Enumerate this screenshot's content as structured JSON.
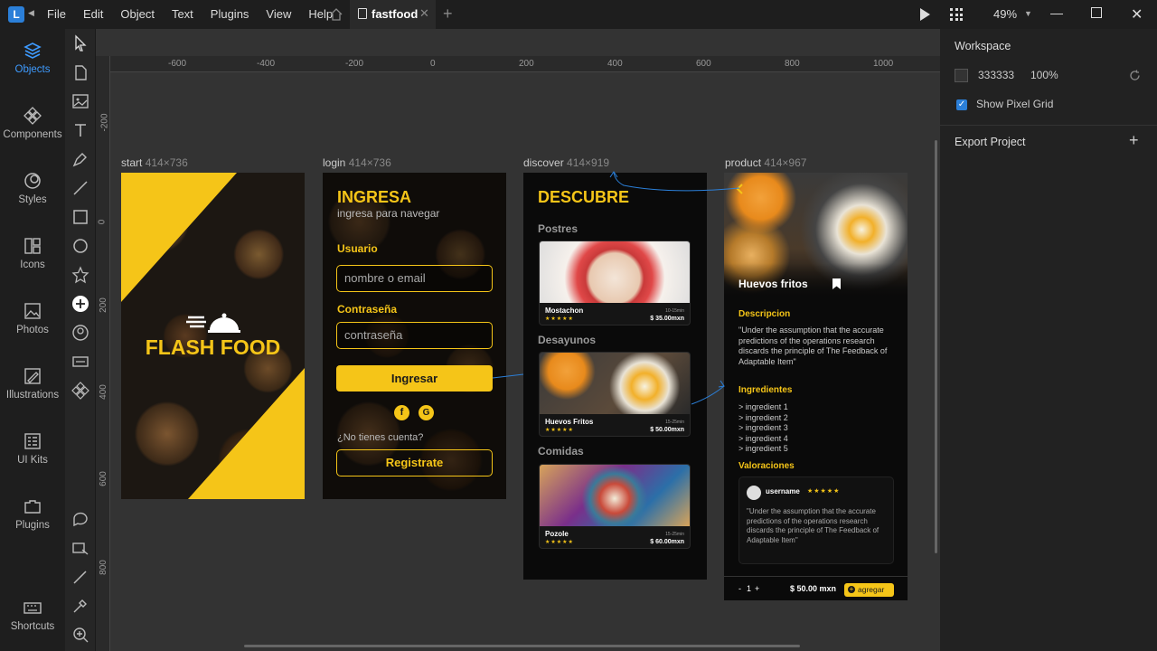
{
  "app": {
    "menu": [
      "File",
      "Edit",
      "Object",
      "Text",
      "Plugins",
      "View",
      "Help"
    ],
    "tab_name": "fastfood",
    "zoom": "49%"
  },
  "leftbar": {
    "items": [
      {
        "label": "Objects",
        "icon": "layers-icon"
      },
      {
        "label": "Components",
        "icon": "components-icon"
      },
      {
        "label": "Styles",
        "icon": "styles-icon"
      },
      {
        "label": "Icons",
        "icon": "icons-icon"
      },
      {
        "label": "Photos",
        "icon": "photos-icon"
      },
      {
        "label": "Illustrations",
        "icon": "illustrations-icon"
      },
      {
        "label": "UI Kits",
        "icon": "ui-kits-icon"
      },
      {
        "label": "Plugins",
        "icon": "plugins-icon"
      },
      {
        "label": "Shortcuts",
        "icon": "keyboard-icon"
      }
    ]
  },
  "rulers": {
    "h": [
      "-600",
      "-400",
      "-200",
      "0",
      "200",
      "400",
      "600",
      "800",
      "1000"
    ],
    "v": [
      "-200",
      "0",
      "200",
      "400",
      "600",
      "800"
    ]
  },
  "right_panel": {
    "workspace_title": "Workspace",
    "color_value": "333333",
    "opacity": "100%",
    "pixel_grid_label": "Show Pixel Grid",
    "export_title": "Export Project"
  },
  "artboards": {
    "start": {
      "name": "start",
      "size": "414×736",
      "title": "FLASH FOOD"
    },
    "login": {
      "name": "login",
      "size": "414×736",
      "title": "INGRESA",
      "subtitle": "ingresa para navegar",
      "user_label": "Usuario",
      "user_placeholder": "nombre o email",
      "pass_label": "Contraseña",
      "pass_placeholder": "contraseña",
      "login_button": "Ingresar",
      "no_account": "¿No tienes cuenta?",
      "register_button": "Registrate",
      "social_f": "f",
      "social_g": "G"
    },
    "discover": {
      "name": "discover",
      "size": "414×919",
      "title": "DESCUBRE",
      "sections": [
        {
          "title": "Postres",
          "item": {
            "name": "Mostachon",
            "time": "10-15min",
            "price": "$ 35.00mxn",
            "stars": "★★★★★"
          }
        },
        {
          "title": "Desayunos",
          "item": {
            "name": "Huevos Fritos",
            "time": "15-25min",
            "price": "$ 50.00mxn",
            "stars": "★★★★★"
          }
        },
        {
          "title": "Comidas",
          "item": {
            "name": "Pozole",
            "time": "15-25min",
            "price": "$ 60.00mxn",
            "stars": "★★★★★"
          }
        }
      ]
    },
    "product": {
      "name": "product",
      "size": "414×967",
      "title": "Huevos fritos",
      "desc_title": "Descripcion",
      "desc_text": "\"Under the assumption that the accurate predictions of the operations research discards the principle of The Feedback of Adaptable Item\"",
      "ing_title": "Ingredientes",
      "ingredients": [
        "> ingredient 1",
        "> ingredient 2",
        "> ingredient 3",
        "> ingredient 4",
        "> ingredient 5"
      ],
      "rev_title": "Valoraciones",
      "review_user": "username",
      "review_stars": "★★★★★",
      "review_text": "\"Under the assumption that the accurate predictions of the operations research discards the principle of The Feedback of Adaptable Item\"",
      "qty_minus": "-",
      "qty": "1",
      "qty_plus": "+",
      "price": "$ 50.00 mxn",
      "add_button": "agregar"
    }
  }
}
